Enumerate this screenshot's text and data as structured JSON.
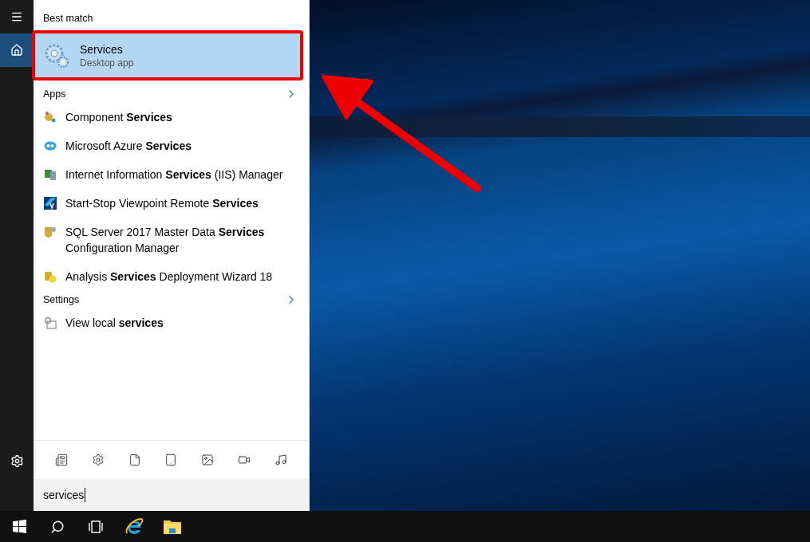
{
  "rail": {
    "items": [
      {
        "kind": "menu",
        "selected": false
      },
      {
        "kind": "home",
        "selected": true
      }
    ],
    "footer": {
      "kind": "settings"
    }
  },
  "best_match": {
    "heading": "Best match",
    "item": {
      "title": "Services",
      "subtitle": "Desktop app",
      "selected": true,
      "highlighted": true
    }
  },
  "sections": [
    {
      "heading": "Apps",
      "items": [
        {
          "text": "Component **Services**"
        },
        {
          "text": "Microsoft Azure **Services**"
        },
        {
          "text": "Internet Information **Services** (IIS) Manager"
        },
        {
          "text": "Start-Stop Viewpoint Remote **Services**"
        },
        {
          "text": "SQL Server 2017 Master Data **Services** Configuration Manager"
        },
        {
          "text": "Analysis **Services** Deployment Wizard 18"
        }
      ]
    },
    {
      "heading": "Settings",
      "items": [
        {
          "text": "View local **services**"
        }
      ]
    }
  ],
  "search": {
    "value": "services"
  },
  "annotation": {
    "arrow": true
  }
}
